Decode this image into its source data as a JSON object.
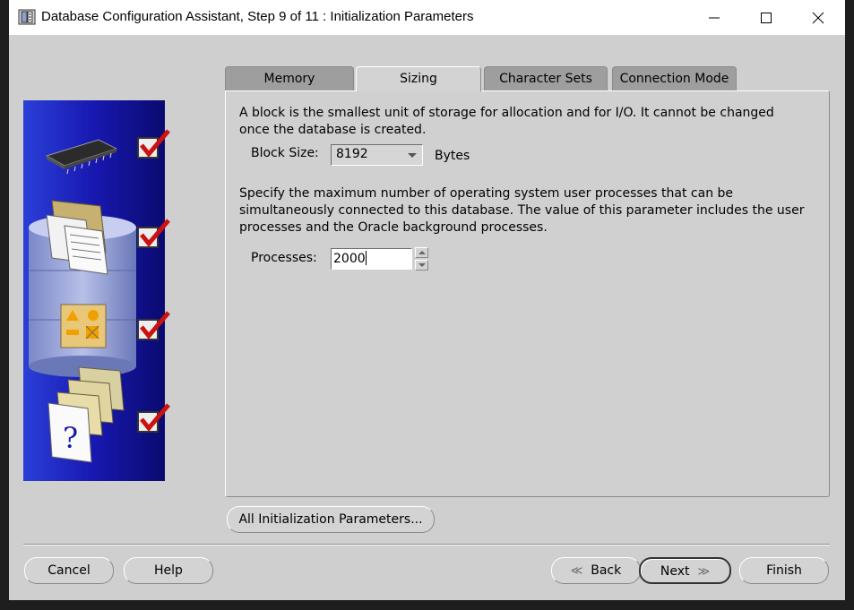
{
  "window": {
    "title": "Database Configuration Assistant, Step 9 of 11 : Initialization Parameters",
    "app_icon": "database-icon",
    "controls": {
      "minimize_icon": "minimize-icon",
      "maximize_icon": "maximize-icon",
      "close_icon": "close-icon"
    }
  },
  "tabs": [
    {
      "label": "Memory",
      "active": false
    },
    {
      "label": "Sizing",
      "active": true
    },
    {
      "label": "Character Sets",
      "active": false
    },
    {
      "label": "Connection Mode",
      "active": false
    }
  ],
  "sizing": {
    "block_desc_line1": "A block is the smallest unit of storage for allocation and for I/O. It cannot be changed",
    "block_desc_line2": "once the database is created.",
    "block_size_label": "Block Size:",
    "block_size_value": "8192",
    "block_size_unit": "Bytes",
    "proc_desc_line1": "Specify the maximum number of operating system user processes that can be",
    "proc_desc_line2": "simultaneously connected to this database. The value of this parameter includes the user",
    "proc_desc_line3": "processes and the Oracle background processes.",
    "processes_label": "Processes:",
    "processes_value": "2000"
  },
  "buttons": {
    "all_params": "All Initialization Parameters...",
    "cancel": "Cancel",
    "help": "Help",
    "back": "Back",
    "next": "Next",
    "finish": "Finish"
  },
  "sidebar": {
    "steps": [
      {
        "icon": "memory-chip-icon",
        "checked": true
      },
      {
        "icon": "documents-database-icon",
        "checked": true
      },
      {
        "icon": "shapes-icon",
        "checked": true
      },
      {
        "icon": "help-document-icon",
        "checked": true
      }
    ]
  },
  "colors": {
    "sidebar_blue": "#1a1aa8",
    "check_red": "#cc1111",
    "window_bg": "#cfcfcf"
  }
}
